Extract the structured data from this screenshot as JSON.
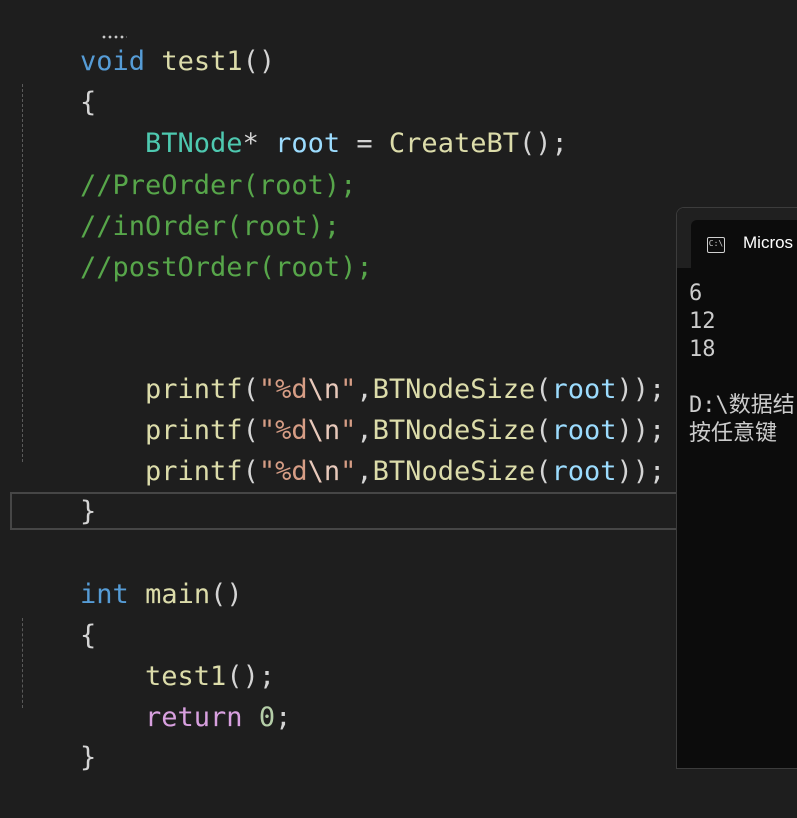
{
  "editor": {
    "lines": [
      {
        "tokens": [
          "void",
          " ",
          "test1",
          "()"
        ]
      },
      {
        "tokens": [
          "{"
        ]
      },
      {
        "tokens": [
          "BTNode",
          "*",
          " ",
          "root",
          " = ",
          "CreateBT",
          "();"
        ]
      },
      {
        "tokens": []
      },
      {
        "tokens": [
          "//PreOrder(root);"
        ]
      },
      {
        "tokens": [
          "//inOrder(root);"
        ]
      },
      {
        "tokens": [
          "//postOrder(root);"
        ]
      },
      {
        "tokens": []
      },
      {
        "tokens": [
          "printf",
          "(",
          "\"",
          "%d",
          "\\n",
          "\"",
          ",",
          "BTNodeSize",
          "(",
          "root",
          "));"
        ]
      },
      {
        "tokens": [
          "printf",
          "(",
          "\"",
          "%d",
          "\\n",
          "\"",
          ",",
          "BTNodeSize",
          "(",
          "root",
          "));"
        ]
      },
      {
        "tokens": [
          "printf",
          "(",
          "\"",
          "%d",
          "\\n",
          "\"",
          ",",
          "BTNodeSize",
          "(",
          "root",
          "));"
        ]
      },
      {
        "tokens": [
          "}"
        ]
      },
      {
        "tokens": []
      },
      {
        "tokens": [
          "int",
          " ",
          "main",
          "()"
        ]
      },
      {
        "tokens": [
          "{"
        ]
      },
      {
        "tokens": [
          "test1",
          "();"
        ]
      },
      {
        "tokens": [
          "return",
          " ",
          "0",
          ";"
        ]
      },
      {
        "tokens": [
          "}"
        ]
      }
    ]
  },
  "console": {
    "tab_icon": "C:\\",
    "tab_title": "Micros",
    "output": [
      "6",
      "12",
      "18",
      "",
      "D:\\数据结",
      "按任意键"
    ]
  },
  "colors": {
    "background": "#1e1e1e",
    "keyword": "#569cd6",
    "control_keyword": "#d8a0df",
    "type": "#4ec9b0",
    "function": "#dcdcaa",
    "variable": "#9cdcfe",
    "comment": "#57a64a",
    "string": "#d69d85",
    "number": "#b5cea8",
    "console_bg": "#0c0c0c"
  },
  "icons": {
    "console_tab": "terminal-icon"
  }
}
